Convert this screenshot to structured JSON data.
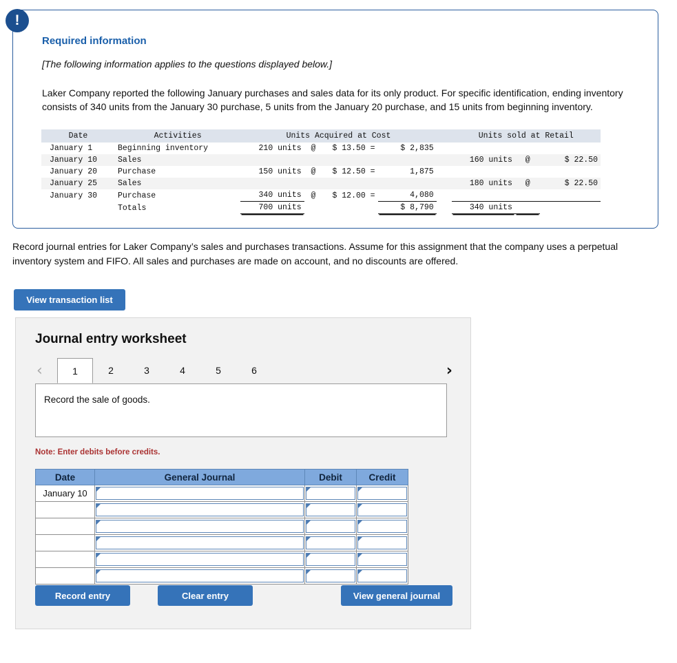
{
  "callout": {
    "badge_icon": "exclamation-icon",
    "title": "Required information",
    "italic_note": "[The following information applies to the questions displayed below.]",
    "paragraph": "Laker Company reported the following January purchases and sales data for its only product. For specific identification, ending inventory consists of 340 units from the January 30 purchase, 5 units from the January 20 purchase, and 15 units from beginning inventory."
  },
  "data_table": {
    "headers": {
      "date": "Date",
      "activities": "Activities",
      "acquired": "Units Acquired at Cost",
      "sold": "Units sold at Retail"
    },
    "rows": [
      {
        "date": "January 1",
        "activity": "Beginning inventory",
        "units": "210 units",
        "at": "@",
        "price": "$ 13.50 =",
        "ext": "$ 2,835",
        "sold_units": "",
        "sold_at": "",
        "sold_price": ""
      },
      {
        "date": "January 10",
        "activity": "Sales",
        "units": "",
        "at": "",
        "price": "",
        "ext": "",
        "sold_units": "160 units",
        "sold_at": "@",
        "sold_price": "$ 22.50"
      },
      {
        "date": "January 20",
        "activity": "Purchase",
        "units": "150 units",
        "at": "@",
        "price": "$ 12.50 =",
        "ext": "1,875",
        "sold_units": "",
        "sold_at": "",
        "sold_price": ""
      },
      {
        "date": "January 25",
        "activity": "Sales",
        "units": "",
        "at": "",
        "price": "",
        "ext": "",
        "sold_units": "180 units",
        "sold_at": "@",
        "sold_price": "$ 22.50"
      },
      {
        "date": "January 30",
        "activity": "Purchase",
        "units": "340 units",
        "at": "@",
        "price": "$ 12.00 =",
        "ext": "4,080",
        "sold_units": "",
        "sold_at": "",
        "sold_price": ""
      }
    ],
    "totals": {
      "date": "",
      "activity": "Totals",
      "units": "700 units",
      "at": "",
      "price": "",
      "ext": "$ 8,790",
      "sold_units": "340 units",
      "sold_at": "",
      "sold_price": ""
    }
  },
  "instruction": "Record journal entries for Laker Company’s sales and purchases transactions. Assume for this assignment that the company uses a perpetual inventory system and FIFO. All sales and purchases are made on account, and no discounts are offered.",
  "buttons": {
    "view_transaction_list": "View transaction list",
    "record_entry": "Record entry",
    "clear_entry": "Clear entry",
    "view_general_journal": "View general journal"
  },
  "worksheet": {
    "title": "Journal entry worksheet",
    "prev_arrow": "‹",
    "next_arrow": "›",
    "tabs": [
      {
        "label": "1",
        "active": true
      },
      {
        "label": "2",
        "active": false
      },
      {
        "label": "3",
        "active": false
      },
      {
        "label": "4",
        "active": false
      },
      {
        "label": "5",
        "active": false
      },
      {
        "label": "6",
        "active": false
      }
    ],
    "pane_text": "Record the sale of goods.",
    "note": "Note: Enter debits before credits.",
    "journal": {
      "headers": [
        "Date",
        "General Journal",
        "Debit",
        "Credit"
      ],
      "rows": [
        {
          "date": "January 10",
          "general_journal": "",
          "debit": "",
          "credit": ""
        },
        {
          "date": "",
          "general_journal": "",
          "debit": "",
          "credit": ""
        },
        {
          "date": "",
          "general_journal": "",
          "debit": "",
          "credit": ""
        },
        {
          "date": "",
          "general_journal": "",
          "debit": "",
          "credit": ""
        },
        {
          "date": "",
          "general_journal": "",
          "debit": "",
          "credit": ""
        },
        {
          "date": "",
          "general_journal": "",
          "debit": "",
          "credit": ""
        }
      ]
    }
  },
  "colors": {
    "badge": "#1c4f8f",
    "callout_border": "#2a5d9e",
    "title_blue": "#1a5faa",
    "button_blue": "#3573b9",
    "table_header_blue": "#7fa9dd",
    "note_red": "#aa3333"
  }
}
